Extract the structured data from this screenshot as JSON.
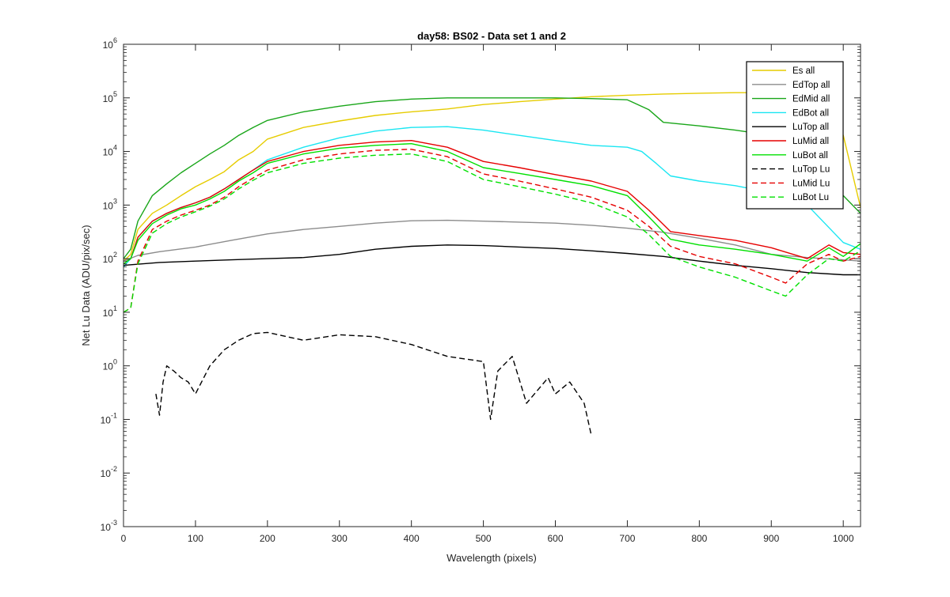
{
  "chart_data": {
    "type": "line",
    "title": "day58: BS02 - Data set 1 and 2",
    "xlabel": "Wavelength (pixels)",
    "ylabel": "Net Lu Data (ADU/pix/sec)",
    "xlim": [
      0,
      1024
    ],
    "ylim": [
      0.001,
      1000000
    ],
    "yscale": "log",
    "x_ticks": [
      0,
      100,
      200,
      300,
      400,
      500,
      600,
      700,
      800,
      900,
      1000
    ],
    "x_tick_labels": [
      "0",
      "100",
      "200",
      "300",
      "400",
      "500",
      "600",
      "700",
      "800",
      "900",
      "1000"
    ],
    "y_ticks": [
      0.001,
      0.01,
      0.1,
      1,
      10,
      100,
      1000,
      10000,
      100000,
      1000000
    ],
    "y_tick_labels": [
      {
        "base": "10",
        "exp": "-3"
      },
      {
        "base": "10",
        "exp": "-2"
      },
      {
        "base": "10",
        "exp": "-1"
      },
      {
        "base": "10",
        "exp": "0"
      },
      {
        "base": "10",
        "exp": "1"
      },
      {
        "base": "10",
        "exp": "2"
      },
      {
        "base": "10",
        "exp": "3"
      },
      {
        "base": "10",
        "exp": "4"
      },
      {
        "base": "10",
        "exp": "5"
      },
      {
        "base": "10",
        "exp": "6"
      }
    ],
    "grid": false,
    "legend_position": "top-right",
    "series": [
      {
        "name": "Es  all",
        "color": "#e6cc00",
        "dash": "solid",
        "x": [
          0,
          10,
          20,
          40,
          60,
          80,
          100,
          120,
          140,
          160,
          180,
          200,
          250,
          300,
          350,
          400,
          450,
          500,
          550,
          600,
          650,
          700,
          750,
          800,
          850,
          900,
          950,
          980,
          1000,
          1024
        ],
        "y": [
          90,
          120,
          350,
          700,
          1000,
          1500,
          2200,
          3000,
          4200,
          7000,
          10000,
          17000,
          28000,
          37000,
          47000,
          55000,
          62000,
          75000,
          85000,
          95000,
          105000,
          112000,
          118000,
          122000,
          125000,
          125000,
          122000,
          120000,
          20000,
          900
        ]
      },
      {
        "name": "EdTop  all",
        "color": "#8c8c8c",
        "dash": "solid",
        "x": [
          0,
          20,
          50,
          100,
          150,
          200,
          250,
          300,
          350,
          400,
          450,
          500,
          550,
          600,
          650,
          700,
          750,
          800,
          850,
          900,
          950,
          1000,
          1024
        ],
        "y": [
          90,
          115,
          135,
          165,
          220,
          290,
          350,
          400,
          460,
          510,
          520,
          500,
          480,
          460,
          420,
          370,
          310,
          240,
          180,
          120,
          105,
          95,
          90
        ]
      },
      {
        "name": "EdMid  all",
        "color": "#19a619",
        "dash": "solid",
        "x": [
          0,
          10,
          20,
          40,
          60,
          80,
          100,
          120,
          140,
          160,
          180,
          200,
          250,
          300,
          350,
          400,
          450,
          500,
          550,
          600,
          650,
          700,
          730,
          750,
          800,
          850,
          900,
          950,
          1000,
          1024
        ],
        "y": [
          100,
          150,
          500,
          1500,
          2500,
          4000,
          6000,
          9000,
          13000,
          20000,
          28000,
          38000,
          55000,
          70000,
          85000,
          95000,
          100000,
          100000,
          100000,
          100000,
          97000,
          92000,
          60000,
          35000,
          30000,
          25000,
          20000,
          12000,
          1500,
          700
        ]
      },
      {
        "name": "EdBot  all",
        "color": "#19e6f2",
        "dash": "solid",
        "x": [
          0,
          10,
          20,
          40,
          60,
          80,
          100,
          120,
          140,
          160,
          180,
          200,
          250,
          300,
          350,
          400,
          450,
          500,
          550,
          600,
          650,
          700,
          720,
          740,
          760,
          800,
          850,
          900,
          950,
          1000,
          1024
        ],
        "y": [
          70,
          100,
          250,
          500,
          700,
          900,
          1100,
          1400,
          2000,
          3000,
          4500,
          7000,
          12000,
          18000,
          24000,
          28000,
          29000,
          25000,
          20000,
          16000,
          13000,
          12000,
          10000,
          6000,
          3500,
          2800,
          2300,
          1700,
          1000,
          200,
          150
        ]
      },
      {
        "name": "LuTop  all",
        "color": "#000000",
        "dash": "solid",
        "x": [
          0,
          50,
          100,
          150,
          200,
          250,
          300,
          350,
          400,
          450,
          500,
          550,
          600,
          650,
          700,
          750,
          800,
          850,
          900,
          950,
          1000,
          1024
        ],
        "y": [
          75,
          85,
          90,
          95,
          100,
          105,
          120,
          150,
          170,
          180,
          175,
          165,
          155,
          140,
          125,
          110,
          90,
          75,
          65,
          55,
          50,
          50
        ]
      },
      {
        "name": "LuMid  all",
        "color": "#e60000",
        "dash": "solid",
        "x": [
          0,
          10,
          20,
          40,
          60,
          80,
          100,
          120,
          140,
          160,
          180,
          200,
          250,
          300,
          350,
          400,
          450,
          500,
          550,
          600,
          650,
          700,
          730,
          760,
          800,
          850,
          900,
          950,
          980,
          1000,
          1024
        ],
        "y": [
          80,
          100,
          250,
          500,
          700,
          900,
          1100,
          1400,
          2000,
          3000,
          4500,
          6500,
          10000,
          13000,
          15000,
          16000,
          12000,
          6500,
          5000,
          3700,
          2800,
          1800,
          800,
          320,
          270,
          220,
          160,
          100,
          180,
          130,
          120
        ]
      },
      {
        "name": "LuBot  all",
        "color": "#00e000",
        "dash": "solid",
        "x": [
          0,
          10,
          20,
          40,
          60,
          80,
          100,
          120,
          140,
          160,
          180,
          200,
          250,
          300,
          350,
          400,
          450,
          500,
          550,
          600,
          650,
          700,
          730,
          760,
          800,
          850,
          900,
          950,
          980,
          1000,
          1024
        ],
        "y": [
          80,
          100,
          220,
          450,
          650,
          850,
          1000,
          1300,
          1800,
          2800,
          4000,
          6000,
          9000,
          11500,
          13000,
          14000,
          10000,
          5000,
          3900,
          3000,
          2300,
          1500,
          600,
          230,
          180,
          150,
          120,
          90,
          160,
          110,
          190
        ]
      },
      {
        "name": "LuTop  Lu",
        "color": "#000000",
        "dash": "dashed",
        "x": [
          45,
          50,
          55,
          60,
          70,
          80,
          90,
          100,
          120,
          140,
          160,
          180,
          200,
          250,
          300,
          350,
          400,
          450,
          500,
          510,
          520,
          540,
          560,
          590,
          600,
          620,
          640,
          650
        ],
        "y": [
          0.3,
          0.12,
          0.5,
          1.0,
          0.8,
          0.6,
          0.5,
          0.3,
          1.0,
          2.0,
          3.0,
          4.0,
          4.2,
          3.0,
          3.8,
          3.5,
          2.5,
          1.5,
          1.2,
          0.1,
          0.8,
          1.5,
          0.2,
          0.6,
          0.3,
          0.5,
          0.2,
          0.05
        ]
      },
      {
        "name": "LuMid  Lu",
        "color": "#e60000",
        "dash": "dashed",
        "x": [
          0,
          10,
          20,
          40,
          60,
          80,
          100,
          120,
          140,
          160,
          180,
          200,
          250,
          300,
          350,
          400,
          450,
          500,
          550,
          600,
          650,
          700,
          730,
          760,
          800,
          850,
          900,
          920,
          950,
          980,
          1000,
          1024
        ],
        "y": [
          10,
          12,
          90,
          350,
          500,
          650,
          800,
          1000,
          1400,
          2200,
          3200,
          4500,
          7000,
          9000,
          10500,
          11000,
          8000,
          3800,
          2800,
          2000,
          1400,
          800,
          400,
          170,
          110,
          80,
          45,
          35,
          80,
          120,
          90,
          110
        ]
      },
      {
        "name": "LuBot  Lu",
        "color": "#00e000",
        "dash": "dashed",
        "x": [
          0,
          10,
          20,
          40,
          60,
          80,
          100,
          120,
          140,
          160,
          180,
          200,
          250,
          300,
          350,
          400,
          450,
          500,
          550,
          600,
          650,
          700,
          730,
          760,
          800,
          850,
          900,
          920,
          950,
          980,
          1000,
          1024
        ],
        "y": [
          10,
          12,
          80,
          300,
          450,
          600,
          750,
          950,
          1300,
          2000,
          2900,
          4000,
          6000,
          7500,
          8500,
          9000,
          6500,
          3000,
          2200,
          1600,
          1100,
          600,
          280,
          110,
          70,
          45,
          25,
          20,
          50,
          100,
          90,
          140
        ]
      }
    ]
  }
}
